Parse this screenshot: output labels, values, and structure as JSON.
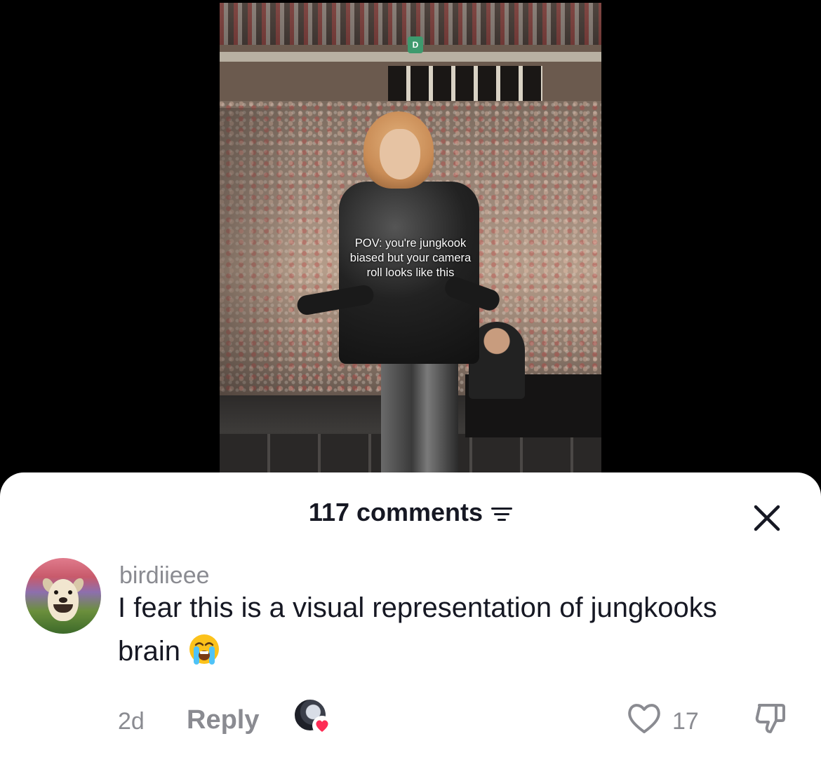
{
  "video": {
    "caption": "POV: you're jungkook\nbiased but your camera\nroll looks like this",
    "sign_letter": "D"
  },
  "comments_panel": {
    "count_label": "117 comments",
    "sort_icon": "sort-lines-icon",
    "close_icon": "close-x-icon"
  },
  "comment": {
    "username": "birdiieee",
    "text": "I fear this is a visual representation of jungkooks brain",
    "emoji": "loudly-crying-face-emoji",
    "time": "2d",
    "reply_label": "Reply",
    "creator_liked": true,
    "like_count": "17",
    "like_icon": "heart-outline-icon",
    "dislike_icon": "thumbs-down-outline-icon"
  },
  "colors": {
    "text_primary": "#161823",
    "text_secondary": "#8a8b91",
    "heart_accent": "#fe2c55",
    "sheet_bg": "#ffffff",
    "backdrop": "#000000"
  }
}
